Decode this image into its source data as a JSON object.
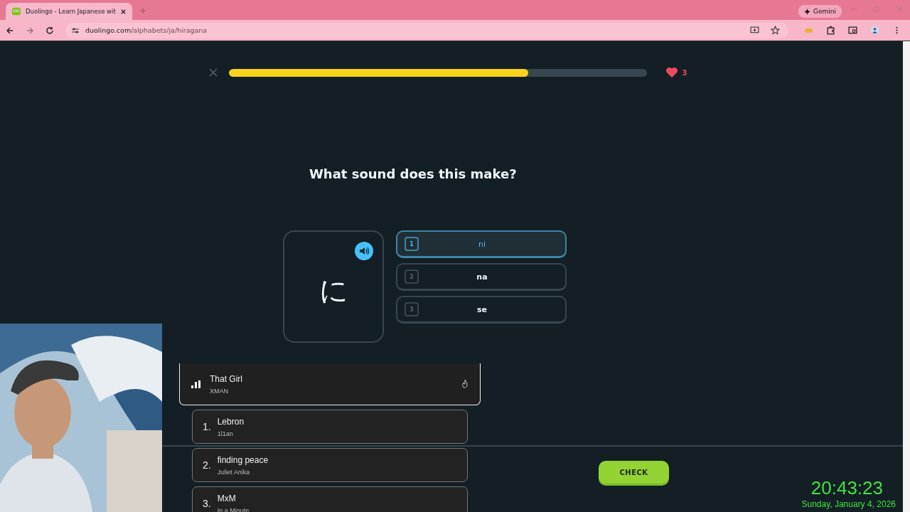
{
  "browser": {
    "tab_title": "Duolingo - Learn Japanese wit",
    "url_domain": "duolingo.com",
    "url_path": "/alphabets/ja/hiragana",
    "gemini": "Gemini"
  },
  "lesson": {
    "progress": {
      "level": 0.716
    },
    "hearts": "3",
    "prompt": "What sound does this make?",
    "character": "に",
    "choices": [
      {
        "number": "1",
        "label": "ni",
        "selected": true
      },
      {
        "number": "2",
        "label": "na",
        "selected": false
      },
      {
        "number": "3",
        "label": "se",
        "selected": false
      }
    ],
    "check": "CHECK"
  },
  "music": {
    "now_playing": {
      "title": "That Girl",
      "artist": "XMAN"
    },
    "queue": [
      {
        "number": "1.",
        "title": "Lebron",
        "artist": "1l1an"
      },
      {
        "number": "2.",
        "title": "finding peace",
        "artist": "Juliet Anika"
      },
      {
        "number": "3.",
        "title": "MxM",
        "artist": "In a Minute"
      }
    ]
  },
  "clock": {
    "time": "20:43:23",
    "date": "Sunday, January 4, 2026"
  }
}
